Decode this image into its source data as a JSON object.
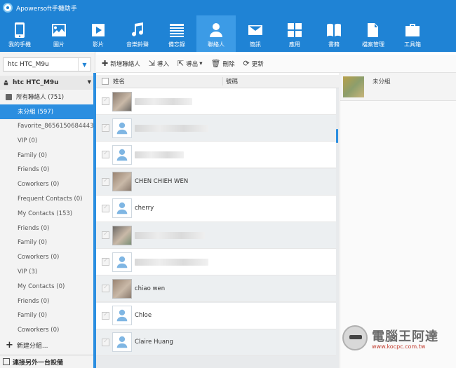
{
  "app": {
    "title": "Apowersoft手機助手"
  },
  "nav": [
    {
      "label": "我的手機",
      "icon": "phone-icon"
    },
    {
      "label": "圖片",
      "icon": "picture-icon"
    },
    {
      "label": "影片",
      "icon": "video-icon"
    },
    {
      "label": "音樂鈴聲",
      "icon": "music-icon"
    },
    {
      "label": "備忘錄",
      "icon": "memo-icon"
    },
    {
      "label": "聯絡人",
      "icon": "contacts-icon",
      "active": true
    },
    {
      "label": "簡訊",
      "icon": "message-icon"
    },
    {
      "label": "應用",
      "icon": "apps-icon"
    },
    {
      "label": "書籍",
      "icon": "book-icon"
    },
    {
      "label": "檔案管理",
      "icon": "file-manager-icon"
    },
    {
      "label": "工具箱",
      "icon": "toolbox-icon"
    }
  ],
  "sidebar": {
    "device_select": "htc HTC_M9u",
    "device_header": "htc HTC_M9u",
    "all_contacts": "所有聯絡人 (751)",
    "groups": [
      {
        "label": "未分組 (597)",
        "selected": true
      },
      {
        "label": "Favorite_8656150684443..."
      },
      {
        "label": "VIP (0)"
      },
      {
        "label": "Family (0)"
      },
      {
        "label": "Friends (0)"
      },
      {
        "label": "Coworkers (0)"
      },
      {
        "label": "Frequent Contacts (0)"
      },
      {
        "label": "My Contacts (153)"
      },
      {
        "label": "Friends (0)"
      },
      {
        "label": "Family (0)"
      },
      {
        "label": "Coworkers (0)"
      },
      {
        "label": "VIP (3)"
      },
      {
        "label": "My Contacts (0)"
      },
      {
        "label": "Friends (0)"
      },
      {
        "label": "Family (0)"
      },
      {
        "label": "Coworkers (0)"
      }
    ],
    "new_group": "新建分組...",
    "connect_other": "連接另外一台設備"
  },
  "actions": [
    {
      "label": "新增聯絡人",
      "icon": "plus-icon",
      "glyph": "✚"
    },
    {
      "label": "導入",
      "icon": "import-icon",
      "glyph": "⇲"
    },
    {
      "label": "導出",
      "icon": "export-icon",
      "glyph": "⇱"
    },
    {
      "label": "刪除",
      "icon": "trash-icon",
      "glyph": "🗑"
    },
    {
      "label": "更新",
      "icon": "refresh-icon",
      "glyph": "⟳"
    }
  ],
  "list": {
    "header_name": "姓名",
    "header_number": "號碼",
    "contacts": [
      {
        "name": "",
        "avatar": "photo",
        "blur_width": 82
      },
      {
        "name": "",
        "avatar": "default",
        "blur_width": 105
      },
      {
        "name": "",
        "avatar": "default",
        "blur_width": 70
      },
      {
        "name": "CHEN CHIEH WEN",
        "avatar": "photo"
      },
      {
        "name": "cherry",
        "avatar": "default"
      },
      {
        "name": "",
        "avatar": "photo",
        "blur_width": 100
      },
      {
        "name": "",
        "avatar": "default",
        "blur_width": 105
      },
      {
        "name": "chiao wen",
        "avatar": "photo"
      },
      {
        "name": "Chloe",
        "avatar": "default"
      },
      {
        "name": "Claire Huang",
        "avatar": "default"
      }
    ]
  },
  "detail": {
    "group_label": "未分組"
  },
  "watermark": {
    "main": "電腦王阿達",
    "url": "www.kocpc.com.tw"
  }
}
